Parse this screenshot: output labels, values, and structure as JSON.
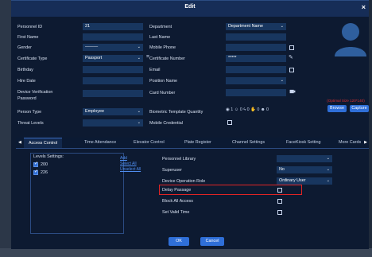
{
  "dialog": {
    "title": "Edit"
  },
  "left": {
    "personnel_id_label": "Personnel ID",
    "personnel_id_value": "21",
    "first_name_label": "First Name",
    "last_name_label_right": "",
    "gender_label": "Gender",
    "gender_value": "———",
    "certificate_type_label": "Certificate Type",
    "certificate_type_value": "Passport",
    "birthday_label": "Birthday",
    "hire_date_label": "Hire Date",
    "device_verification_label_1": "Device Verification",
    "device_verification_label_2": "Password",
    "person_type_label": "Person Type",
    "person_type_value": "Employee",
    "threat_levels_label": "Threat Levels"
  },
  "right": {
    "department_label": "Department",
    "department_value": "Department Name",
    "last_name_label": "Last Name",
    "mobile_phone_label": "Mobile Phone",
    "certificate_number_label": "Certificate Number",
    "certificate_number_value": "*****",
    "email_label": "Email",
    "position_name_label": "Position Name",
    "card_number_label": "Card Number",
    "biometric_label": "Biometric Template Quantity",
    "biometric_counts": [
      "1",
      "0",
      "0",
      "0",
      "0"
    ],
    "mobile_credential_label": "Mobile Credential"
  },
  "photo": {
    "hint": "(Optimal Size 120*140)",
    "browse": "Browse",
    "capture": "Capture"
  },
  "tabs": {
    "prev": "◀",
    "next": "▶",
    "items": [
      "Access Control",
      "Time Attendance",
      "Elevator Control",
      "Plate Register",
      "Channel Settings",
      "FaceKiosk Setting",
      "More Cards"
    ]
  },
  "access": {
    "levels_settings_label": "Levels Settings:",
    "levels": [
      "200",
      "226"
    ],
    "add": "Add",
    "select_all": "Select All",
    "unselect_all": "Unselect All",
    "personnel_library_label": "Personnel Library",
    "superuser_label": "Superuser",
    "superuser_value": "No",
    "device_operation_role_label": "Device Operation Role",
    "device_operation_role_value": "Ordinary User",
    "delay_passage_label": "Delay Passage",
    "block_all_access_label": "Block All Access",
    "set_valid_time_label": "Set Valid Time"
  },
  "footer": {
    "ok": "OK",
    "cancel": "Cancel"
  },
  "colors": {
    "dialog_bg": "#0d1a31",
    "field_bg": "#18365f",
    "accent": "#2f6fd8",
    "highlight": "#e02424",
    "hint": "#e03030"
  }
}
